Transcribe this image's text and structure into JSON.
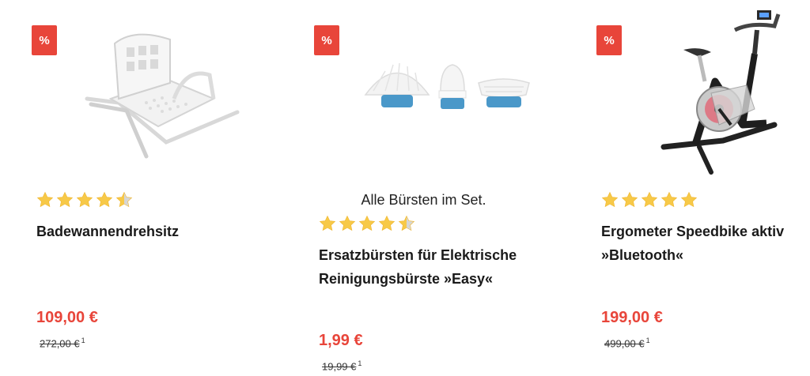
{
  "colors": {
    "accent": "#e8453a",
    "star": "#f7c948"
  },
  "products": [
    {
      "badge": "%",
      "image_icon": "bath-seat-image",
      "rating": 4.5,
      "title_lines": [
        "Badewannendrehsitz"
      ],
      "price": "109,00 €",
      "old_price": "272,00 €",
      "footnote": "1"
    },
    {
      "badge": "%",
      "image_icon": "brush-heads-image",
      "caption": "Alle Bürsten im Set.",
      "rating": 4.5,
      "title_lines": [
        "Ersatzbürsten für Elektrische",
        "Reinigungsbürste »Easy«"
      ],
      "price": "1,99 €",
      "old_price": "19,99 €",
      "footnote": "1"
    },
    {
      "badge": "%",
      "image_icon": "exercise-bike-image",
      "rating": 5,
      "title_lines": [
        "Ergometer Speedbike aktiv",
        "»Bluetooth«"
      ],
      "price": "199,00 €",
      "old_price": "499,00 €",
      "footnote": "1"
    }
  ]
}
